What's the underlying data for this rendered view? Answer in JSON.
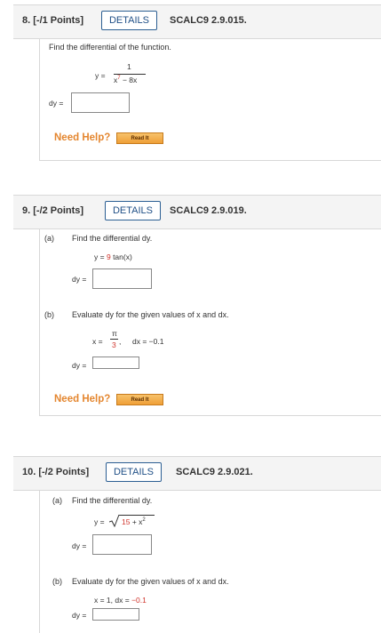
{
  "q8": {
    "number": "8.",
    "points": "[-/1 Points]",
    "details": "DETAILS",
    "code": "SCALC9 2.9.015.",
    "prompt": "Find the differential of the function.",
    "y_eq": "y =",
    "numerator": "1",
    "den_base": "x",
    "den_exp": "7",
    "den_rest": " − 8x",
    "dy_label": "dy =",
    "need_help": "Need Help?",
    "read_it": "Read It"
  },
  "q9": {
    "number": "9.",
    "points": "[-/2 Points]",
    "details": "DETAILS",
    "code": "SCALC9 2.9.019.",
    "part_a_label": "(a)",
    "part_a_text": "Find the differential dy.",
    "y_eq": "y =",
    "coef": "9",
    "func": "tan(x)",
    "dy_label_a": "dy =",
    "part_b_label": "(b)",
    "part_b_text": "Evaluate dy for the given values of x and dx.",
    "x_eq": "x =",
    "x_num": "π",
    "x_den": "3",
    "x_comma": ",",
    "dx_eq": "dx = −0.1",
    "dy_label_b": "dy =",
    "need_help": "Need Help?",
    "read_it": "Read It"
  },
  "q10": {
    "number": "10.",
    "points": "[-/2 Points]",
    "details": "DETAILS",
    "code": "SCALC9 2.9.021.",
    "part_a_label": "(a)",
    "part_a_text": "Find the differential dy.",
    "y_eq": "y =",
    "rad_const": "15",
    "rad_rest": " + x",
    "rad_exp": "2",
    "dy_label_a": "dy =",
    "part_b_label": "(b)",
    "part_b_text": "Evaluate dy for the given values of x and dx.",
    "x_val": "x = 1, dx = ",
    "dx_val": "−0.1",
    "dy_label_b": "dy ="
  }
}
